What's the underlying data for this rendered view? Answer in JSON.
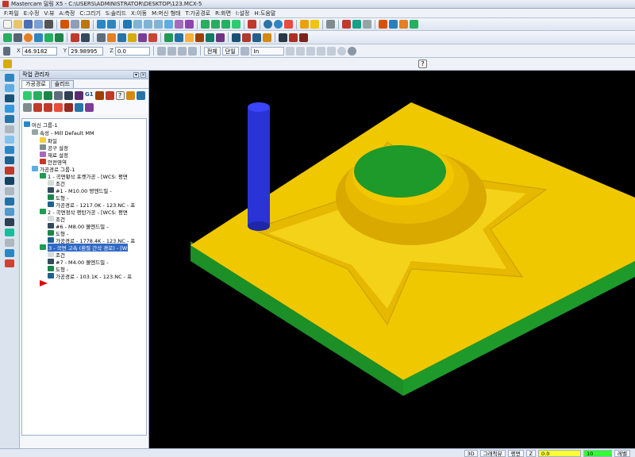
{
  "window": {
    "title": "Mastercam 밀링 X5 - C:\\USERS\\ADMINISTRATOR\\DESKTOP\\123.MCX-5"
  },
  "menu": [
    "F:파일",
    "E:수정",
    "V:뷰",
    "A:측정",
    "C:그리기",
    "S:솔리드",
    "X:이동",
    "M:머신 형태",
    "T:가공경로",
    "R:화면",
    "I:설정",
    "H:도움말"
  ],
  "coords": {
    "x_label": "X",
    "x_value": "46.9182",
    "y_label": "Y",
    "y_value": "29.98995",
    "z_label": "Z",
    "z_value": "0.0"
  },
  "snapbar": {
    "global": "전체",
    "single": "단일",
    "mode": "In"
  },
  "manager": {
    "title": "작업 관리자",
    "tabs": [
      "가공경로",
      "솔리드"
    ],
    "toolbar_text": "G1",
    "tree": [
      {
        "label": "머신 그룹-1",
        "level": 0
      },
      {
        "label": "속성 - Mill Default MM",
        "level": 1
      },
      {
        "label": "파일",
        "level": 2
      },
      {
        "label": "공구 설정",
        "level": 2
      },
      {
        "label": "재료 설정",
        "level": 2
      },
      {
        "label": "안전영역",
        "level": 2
      },
      {
        "label": "가공경로 그룹-1",
        "level": 1
      },
      {
        "label": "1 - 곡면황삭 포켓가공 - [WCS: 평면",
        "level": 2
      },
      {
        "label": "조건",
        "level": 3
      },
      {
        "label": "#1 - M10.00 평엔드밀 -",
        "level": 3
      },
      {
        "label": "도형 -",
        "level": 3
      },
      {
        "label": "가공경로 - 1217.0K - 123.NC - 프",
        "level": 3
      },
      {
        "label": "2 - 곡면정삭 평탄가공 - [WCS: 평면",
        "level": 2
      },
      {
        "label": "조건",
        "level": 3
      },
      {
        "label": "#6 - M8.00 볼엔드밀 -",
        "level": 3
      },
      {
        "label": "도형 -",
        "level": 3
      },
      {
        "label": "가공경로 - 1778.4K - 123.NC - 프",
        "level": 3
      },
      {
        "label": "3 - 곡면 고속 (환절 간삭 경로) - [W",
        "level": 2
      },
      {
        "label": "조건",
        "level": 3
      },
      {
        "label": "#7 - M4.00 볼엔드밀 -",
        "level": 3
      },
      {
        "label": "도형 -",
        "level": 3
      },
      {
        "label": "가공경로 - 103.1K - 123.NC - 프",
        "level": 3
      }
    ],
    "selected_index": 17
  },
  "status": {
    "view": "3D",
    "graphics_view": "그래픽뷰",
    "plane": "평면",
    "z_label": "Z",
    "z_value": "0.0",
    "level_value": "10",
    "level_label": "레벨"
  },
  "colors": {
    "background": "#000000",
    "part_top": "#f0c800",
    "part_side": "#1e9a2a",
    "cylinder": "#2a33d6",
    "accent": "#316ac5"
  }
}
